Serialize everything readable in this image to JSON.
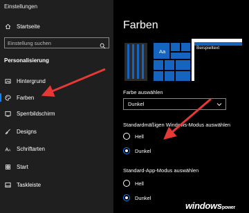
{
  "app": {
    "title": "Einstellungen"
  },
  "sidebar": {
    "home_label": "Startseite",
    "search_placeholder": "Einstellung suchen",
    "section_heading": "Personalisierung",
    "items": [
      {
        "label": "Hintergrund",
        "icon": "image-icon"
      },
      {
        "label": "Farben",
        "icon": "palette-icon",
        "active": true
      },
      {
        "label": "Sperrbildschirm",
        "icon": "lockscreen-icon"
      },
      {
        "label": "Designs",
        "icon": "brush-icon"
      },
      {
        "label": "Schriftarten",
        "icon": "font-icon"
      },
      {
        "label": "Start",
        "icon": "start-icon"
      },
      {
        "label": "Taskleiste",
        "icon": "taskbar-icon"
      }
    ]
  },
  "main": {
    "title": "Farben",
    "preview": {
      "tile_label": "Aa",
      "sample_text": "Beispieltext"
    },
    "color_select": {
      "label": "Farbe auswählen",
      "value": "Dunkel"
    },
    "windows_mode": {
      "label": "Standardmäßigen Windows-Modus auswählen",
      "options": [
        {
          "label": "Hell",
          "checked": false
        },
        {
          "label": "Dunkel",
          "checked": true
        }
      ]
    },
    "app_mode": {
      "label": "Standard-App-Modus auswählen",
      "options": [
        {
          "label": "Hell",
          "checked": false
        },
        {
          "label": "Dunkel",
          "checked": true
        }
      ]
    }
  },
  "watermark": {
    "brand": "windows",
    "suffix": "power"
  },
  "colors": {
    "accent": "#0a84ff",
    "preview_tile": "#1565c0",
    "arrow": "#e53935",
    "sidebar_bg": "#1f1f1f"
  }
}
